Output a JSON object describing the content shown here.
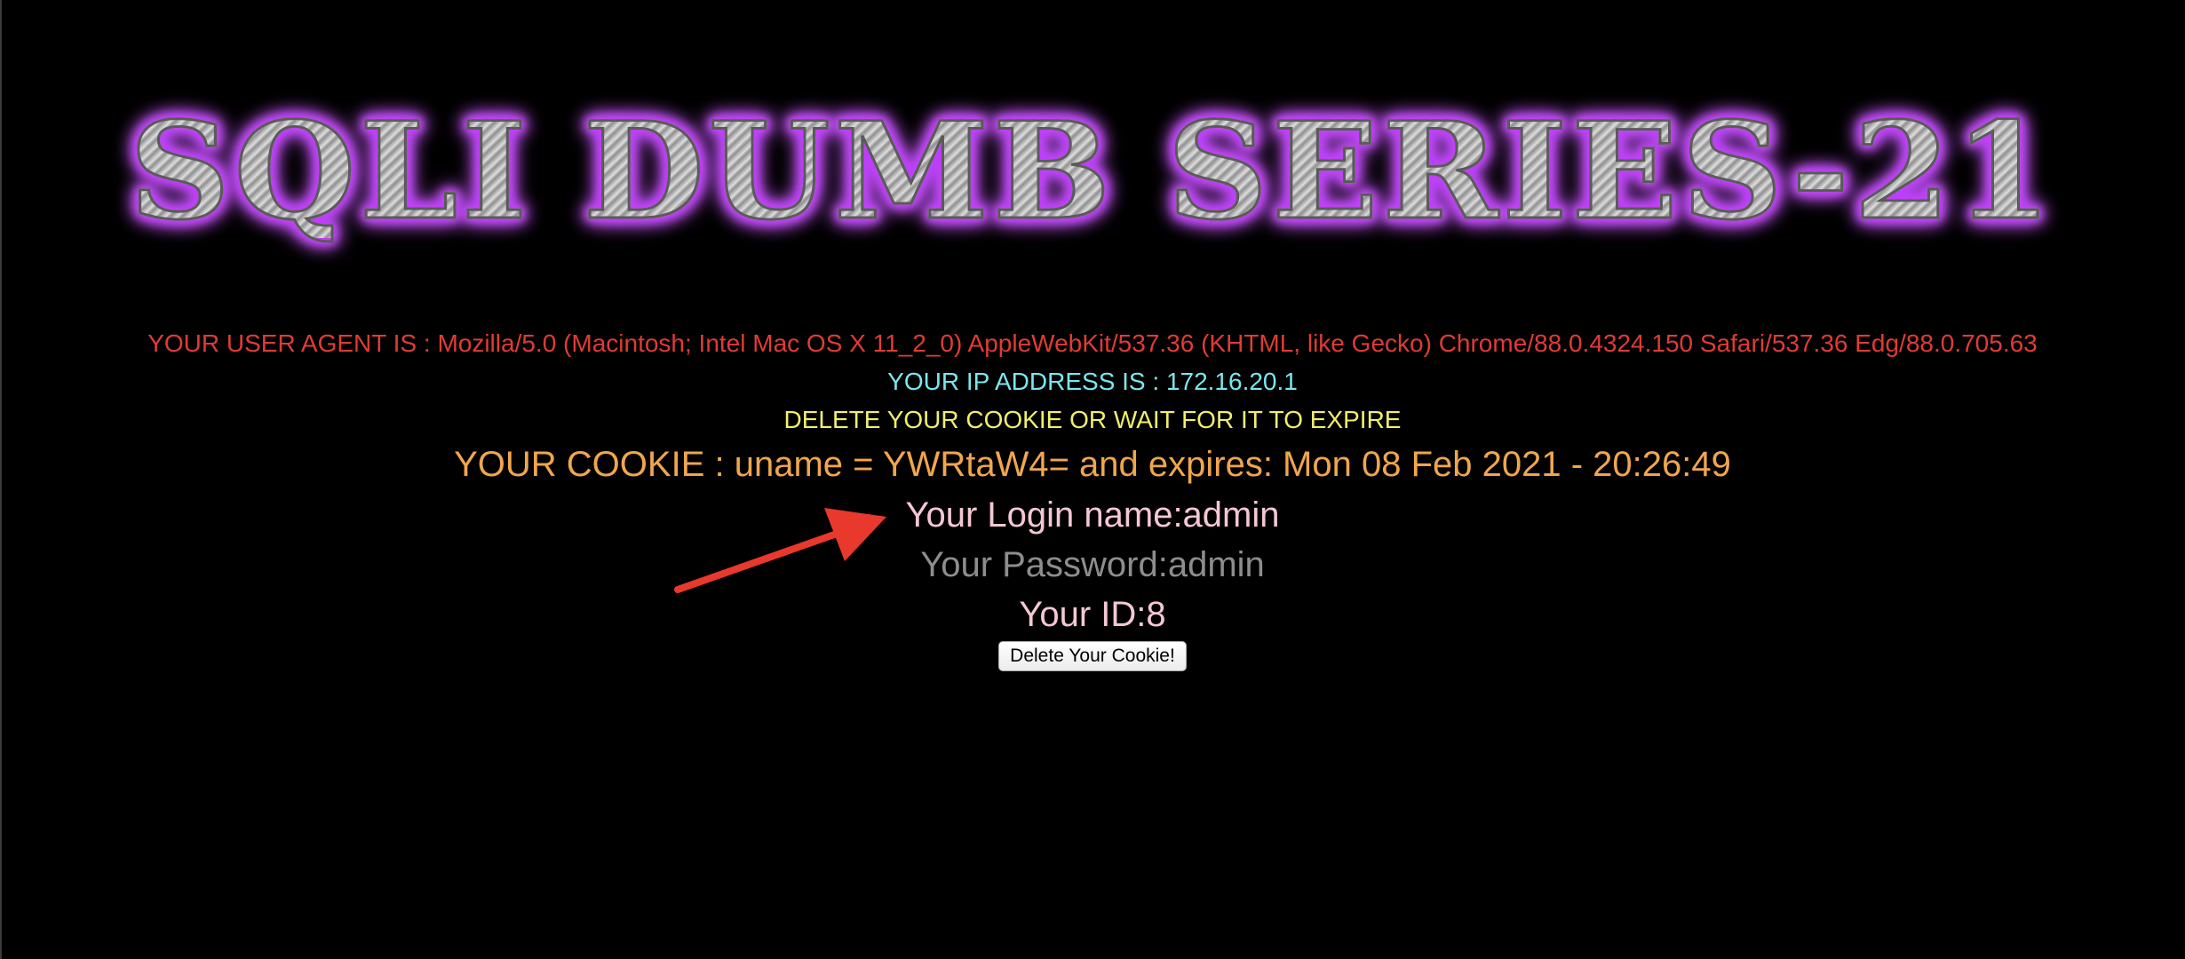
{
  "banner": {
    "title": "SQLI DUMB SERIES-21"
  },
  "info": {
    "user_agent": "YOUR USER AGENT IS : Mozilla/5.0 (Macintosh; Intel Mac OS X 11_2_0) AppleWebKit/537.36 (KHTML, like Gecko) Chrome/88.0.4324.150 Safari/537.36 Edg/88.0.705.63",
    "ip_address": "YOUR IP ADDRESS IS : 172.16.20.1",
    "delete_message": "DELETE YOUR COOKIE OR WAIT FOR IT TO EXPIRE",
    "cookie": "YOUR COOKIE : uname = YWRtaW4= and expires: Mon 08 Feb 2021 - 20:26:49",
    "login_name": "Your Login name:admin",
    "password": "Your Password:admin",
    "user_id": "Your ID:8"
  },
  "actions": {
    "delete_cookie_label": "Delete Your Cookie!"
  },
  "colors": {
    "background": "#000000",
    "user_agent": "#e03b36",
    "ip": "#7be6ee",
    "delete_message": "#f1ee6c",
    "cookie": "#f0a64d",
    "login": "#f4c7d4",
    "password": "#8d8d8d",
    "glow": "#c63bff",
    "annotation_arrow": "#e8392c"
  },
  "annotation": {
    "icon": "red-arrow-icon"
  }
}
